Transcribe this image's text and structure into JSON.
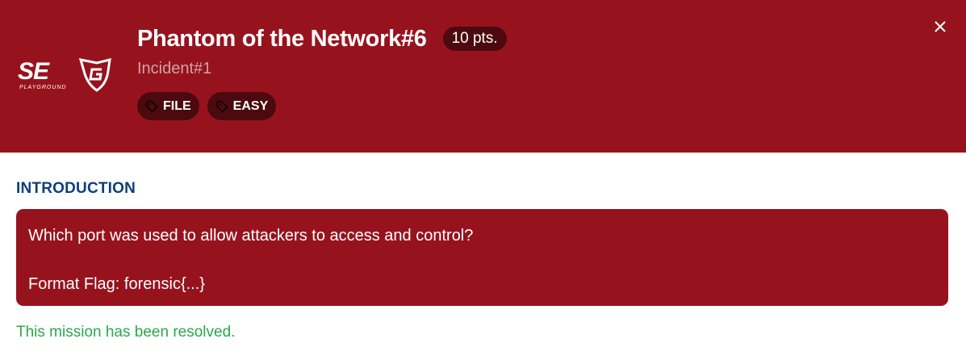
{
  "header": {
    "logo_text": "SEG",
    "logo_subtext": "PLAYGROUND",
    "title": "Phantom of the Network#6",
    "points": "10 pts.",
    "subtitle": "Incident#1",
    "tags": [
      {
        "label": "FILE",
        "icon": "tag-icon"
      },
      {
        "label": "EASY",
        "icon": "tag-icon"
      }
    ],
    "close_icon": "close-icon"
  },
  "introduction": {
    "heading": "INTRODUCTION",
    "lines": [
      "Which port was used to allow attackers to access and control?",
      "Format Flag: forensic{...}"
    ]
  },
  "status": "This mission has been resolved.",
  "colors": {
    "header_bg": "#96131d",
    "badge_bg": "#4c0a0e",
    "heading": "#0c3f7a",
    "status_success": "#2aa84a"
  }
}
